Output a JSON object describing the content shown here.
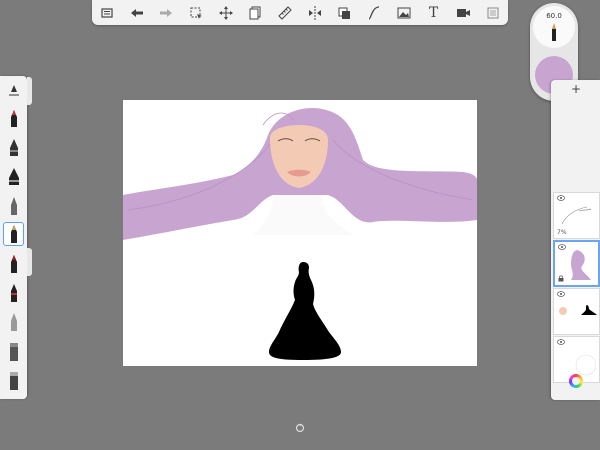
{
  "toolbar": {
    "items": [
      {
        "name": "gallery-button",
        "icon": "gallery-icon"
      },
      {
        "name": "undo-button",
        "icon": "undo-arrow-icon"
      },
      {
        "name": "redo-button",
        "icon": "redo-arrow-icon"
      },
      {
        "name": "selection-tool-button",
        "icon": "selection-icon"
      },
      {
        "name": "transform-tool-button",
        "icon": "move-icon"
      },
      {
        "name": "layers-tool-button",
        "icon": "layers-icon"
      },
      {
        "name": "ruler-tool-button",
        "icon": "ruler-icon"
      },
      {
        "name": "symmetry-tool-button",
        "icon": "symmetry-icon"
      },
      {
        "name": "fill-tool-button",
        "icon": "fill-icon"
      },
      {
        "name": "curve-tool-button",
        "icon": "curve-icon"
      },
      {
        "name": "image-tool-button",
        "icon": "image-icon"
      },
      {
        "name": "text-tool-button",
        "icon": "text-icon",
        "label": "T"
      },
      {
        "name": "record-tool-button",
        "icon": "video-icon"
      },
      {
        "name": "fullscreen-button",
        "icon": "fullscreen-icon"
      }
    ]
  },
  "brush_panel": {
    "brushes": [
      "ruler-brush",
      "marker-brush",
      "ink-pen-brush",
      "felt-pen-brush",
      "pencil-brush",
      "fountain-pen-brush",
      "paint-brush",
      "airbrush-brush",
      "soft-pencil-brush",
      "flat-brush",
      "blender-brush"
    ],
    "selected_index": 4
  },
  "puck": {
    "brush_size": "60.0",
    "current_color": "#c8a5d1"
  },
  "layers": {
    "add_symbol": "+",
    "items": [
      {
        "name": "layer-1-sketch",
        "opacity": "7%",
        "visible": true
      },
      {
        "name": "layer-2-hair",
        "visible": true,
        "active": true
      },
      {
        "name": "layer-3-figure",
        "visible": true
      },
      {
        "name": "layer-4-background",
        "visible": true
      }
    ]
  },
  "colors": {
    "hair": "#c8a5d1",
    "skin": "#f3cbb5",
    "silhouette": "#000000",
    "selection": "#5aa0ff"
  }
}
